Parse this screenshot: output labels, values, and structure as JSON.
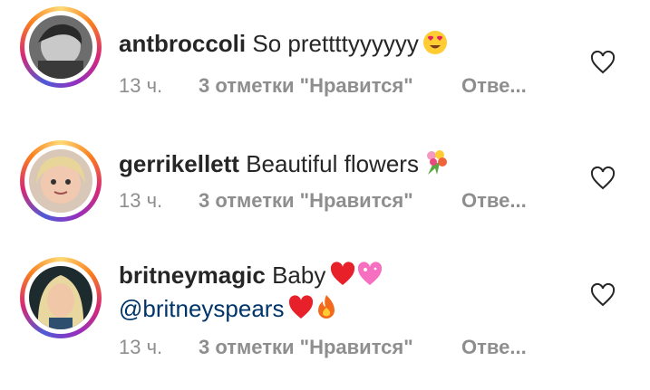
{
  "comments": [
    {
      "username": "antbroccoli",
      "text": "So prettttyyyyyy",
      "emojis": [
        "heart-eyes-emoji"
      ],
      "time": "13 ч.",
      "likes": "3 отметки \"Нравится\"",
      "reply": "Отве..."
    },
    {
      "username": "gerrikellett",
      "text": "Beautiful flowers",
      "emojis": [
        "bouquet-emoji"
      ],
      "time": "13 ч.",
      "likes": "3 отметки \"Нравится\"",
      "reply": "Отве..."
    },
    {
      "username": "britneymagic",
      "text": "Baby",
      "emojis": [
        "red-heart-emoji",
        "sparkling-heart-emoji"
      ],
      "mention": "@britneyspears",
      "mention_emojis": [
        "red-heart-emoji",
        "fire-emoji"
      ],
      "time": "13 ч.",
      "likes": "3 отметки \"Нравится\"",
      "reply": "Отве..."
    }
  ],
  "colors": {
    "text": "#262626",
    "meta": "#8e8e8e",
    "mention": "#003569",
    "heart_outline": "#262626"
  },
  "icons": [
    "heart-outline-icon"
  ]
}
